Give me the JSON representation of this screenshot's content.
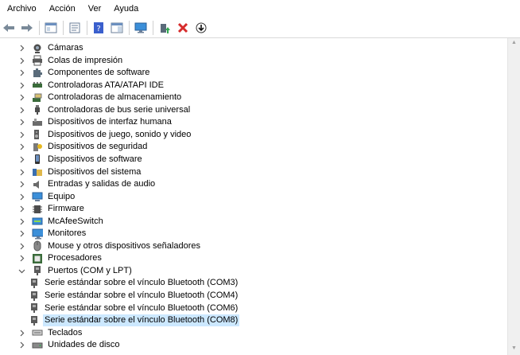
{
  "menu": [
    {
      "label": "Archivo"
    },
    {
      "label": "Acción"
    },
    {
      "label": "Ver"
    },
    {
      "label": "Ayuda"
    }
  ],
  "toolbar": [
    {
      "icon": "back-arrow-icon"
    },
    {
      "icon": "forward-arrow-icon"
    },
    {
      "sep": true
    },
    {
      "icon": "console-tree-icon"
    },
    {
      "sep": true
    },
    {
      "icon": "properties-icon"
    },
    {
      "sep": true
    },
    {
      "icon": "help-icon"
    },
    {
      "icon": "action-pane-icon"
    },
    {
      "sep": true
    },
    {
      "icon": "monitor-icon"
    },
    {
      "sep": true
    },
    {
      "icon": "update-driver-icon"
    },
    {
      "icon": "uninstall-icon"
    },
    {
      "icon": "download-icon"
    }
  ],
  "tree": [
    {
      "label": "Cámaras",
      "icon": "camera-icon",
      "expanded": false
    },
    {
      "label": "Colas de impresión",
      "icon": "printer-icon",
      "expanded": false
    },
    {
      "label": "Componentes de software",
      "icon": "puzzle-icon",
      "expanded": false
    },
    {
      "label": "Controladoras ATA/ATAPI IDE",
      "icon": "ide-controller-icon",
      "expanded": false
    },
    {
      "label": "Controladoras de almacenamiento",
      "icon": "storage-controller-icon",
      "expanded": false
    },
    {
      "label": "Controladoras de bus serie universal",
      "icon": "usb-icon",
      "expanded": false
    },
    {
      "label": "Dispositivos de interfaz humana",
      "icon": "hid-icon",
      "expanded": false
    },
    {
      "label": "Dispositivos de juego, sonido y video",
      "icon": "speaker-icon",
      "expanded": false
    },
    {
      "label": "Dispositivos de seguridad",
      "icon": "key-icon",
      "expanded": false
    },
    {
      "label": "Dispositivos de software",
      "icon": "phone-icon",
      "expanded": false
    },
    {
      "label": "Dispositivos del sistema",
      "icon": "folder-chip-icon",
      "expanded": false
    },
    {
      "label": "Entradas y salidas de audio",
      "icon": "audio-icon",
      "expanded": false
    },
    {
      "label": "Equipo",
      "icon": "computer-icon",
      "expanded": false
    },
    {
      "label": "Firmware",
      "icon": "firmware-icon",
      "expanded": false
    },
    {
      "label": "McAfeeSwitch",
      "icon": "network-switch-icon",
      "expanded": false
    },
    {
      "label": "Monitores",
      "icon": "monitor-icon",
      "expanded": false
    },
    {
      "label": "Mouse y otros dispositivos señaladores",
      "icon": "mouse-icon",
      "expanded": false
    },
    {
      "label": "Procesadores",
      "icon": "cpu-icon",
      "expanded": false
    },
    {
      "label": "Puertos (COM y LPT)",
      "icon": "port-icon",
      "expanded": true
    },
    {
      "label": "Serie estándar sobre el vínculo Bluetooth (COM3)",
      "icon": "port-icon",
      "child": true
    },
    {
      "label": "Serie estándar sobre el vínculo Bluetooth (COM4)",
      "icon": "port-icon",
      "child": true
    },
    {
      "label": "Serie estándar sobre el vínculo Bluetooth (COM6)",
      "icon": "port-icon",
      "child": true
    },
    {
      "label": "Serie estándar sobre el vínculo Bluetooth (COM8)",
      "icon": "port-icon",
      "child": true,
      "selected": true
    },
    {
      "label": "Teclados",
      "icon": "keyboard-icon",
      "expanded": false
    },
    {
      "label": "Unidades de disco",
      "icon": "disk-icon",
      "expanded": false
    }
  ]
}
